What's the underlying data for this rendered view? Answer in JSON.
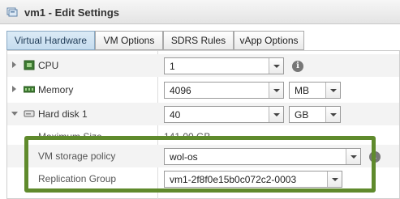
{
  "window": {
    "title": "vm1 - Edit Settings",
    "title_icon": "vm-settings-icon"
  },
  "tabs": [
    {
      "label": "Virtual Hardware",
      "active": true
    },
    {
      "label": "VM Options",
      "active": false
    },
    {
      "label": "SDRS Rules",
      "active": false
    },
    {
      "label": "vApp Options",
      "active": false
    }
  ],
  "hardware": {
    "cpu": {
      "label": "CPU",
      "icon": "cpu-icon",
      "value": "1"
    },
    "memory": {
      "label": "Memory",
      "icon": "memory-icon",
      "value": "4096",
      "unit": "MB"
    },
    "hard_disk": {
      "label": "Hard disk 1",
      "icon": "hard-disk-icon",
      "value": "40",
      "unit": "GB",
      "max_size_label": "Maximum Size",
      "max_size_value": "141.00 GB",
      "storage_policy_label": "VM storage policy",
      "storage_policy_value": "wol-os",
      "replication_group_label": "Replication Group",
      "replication_group_value": "vm1-2f8f0e15b0c072c2-0003"
    }
  },
  "info_glyph": "i",
  "colors": {
    "highlight_border": "#5f8a2c",
    "active_tab": "#c5dcef"
  }
}
